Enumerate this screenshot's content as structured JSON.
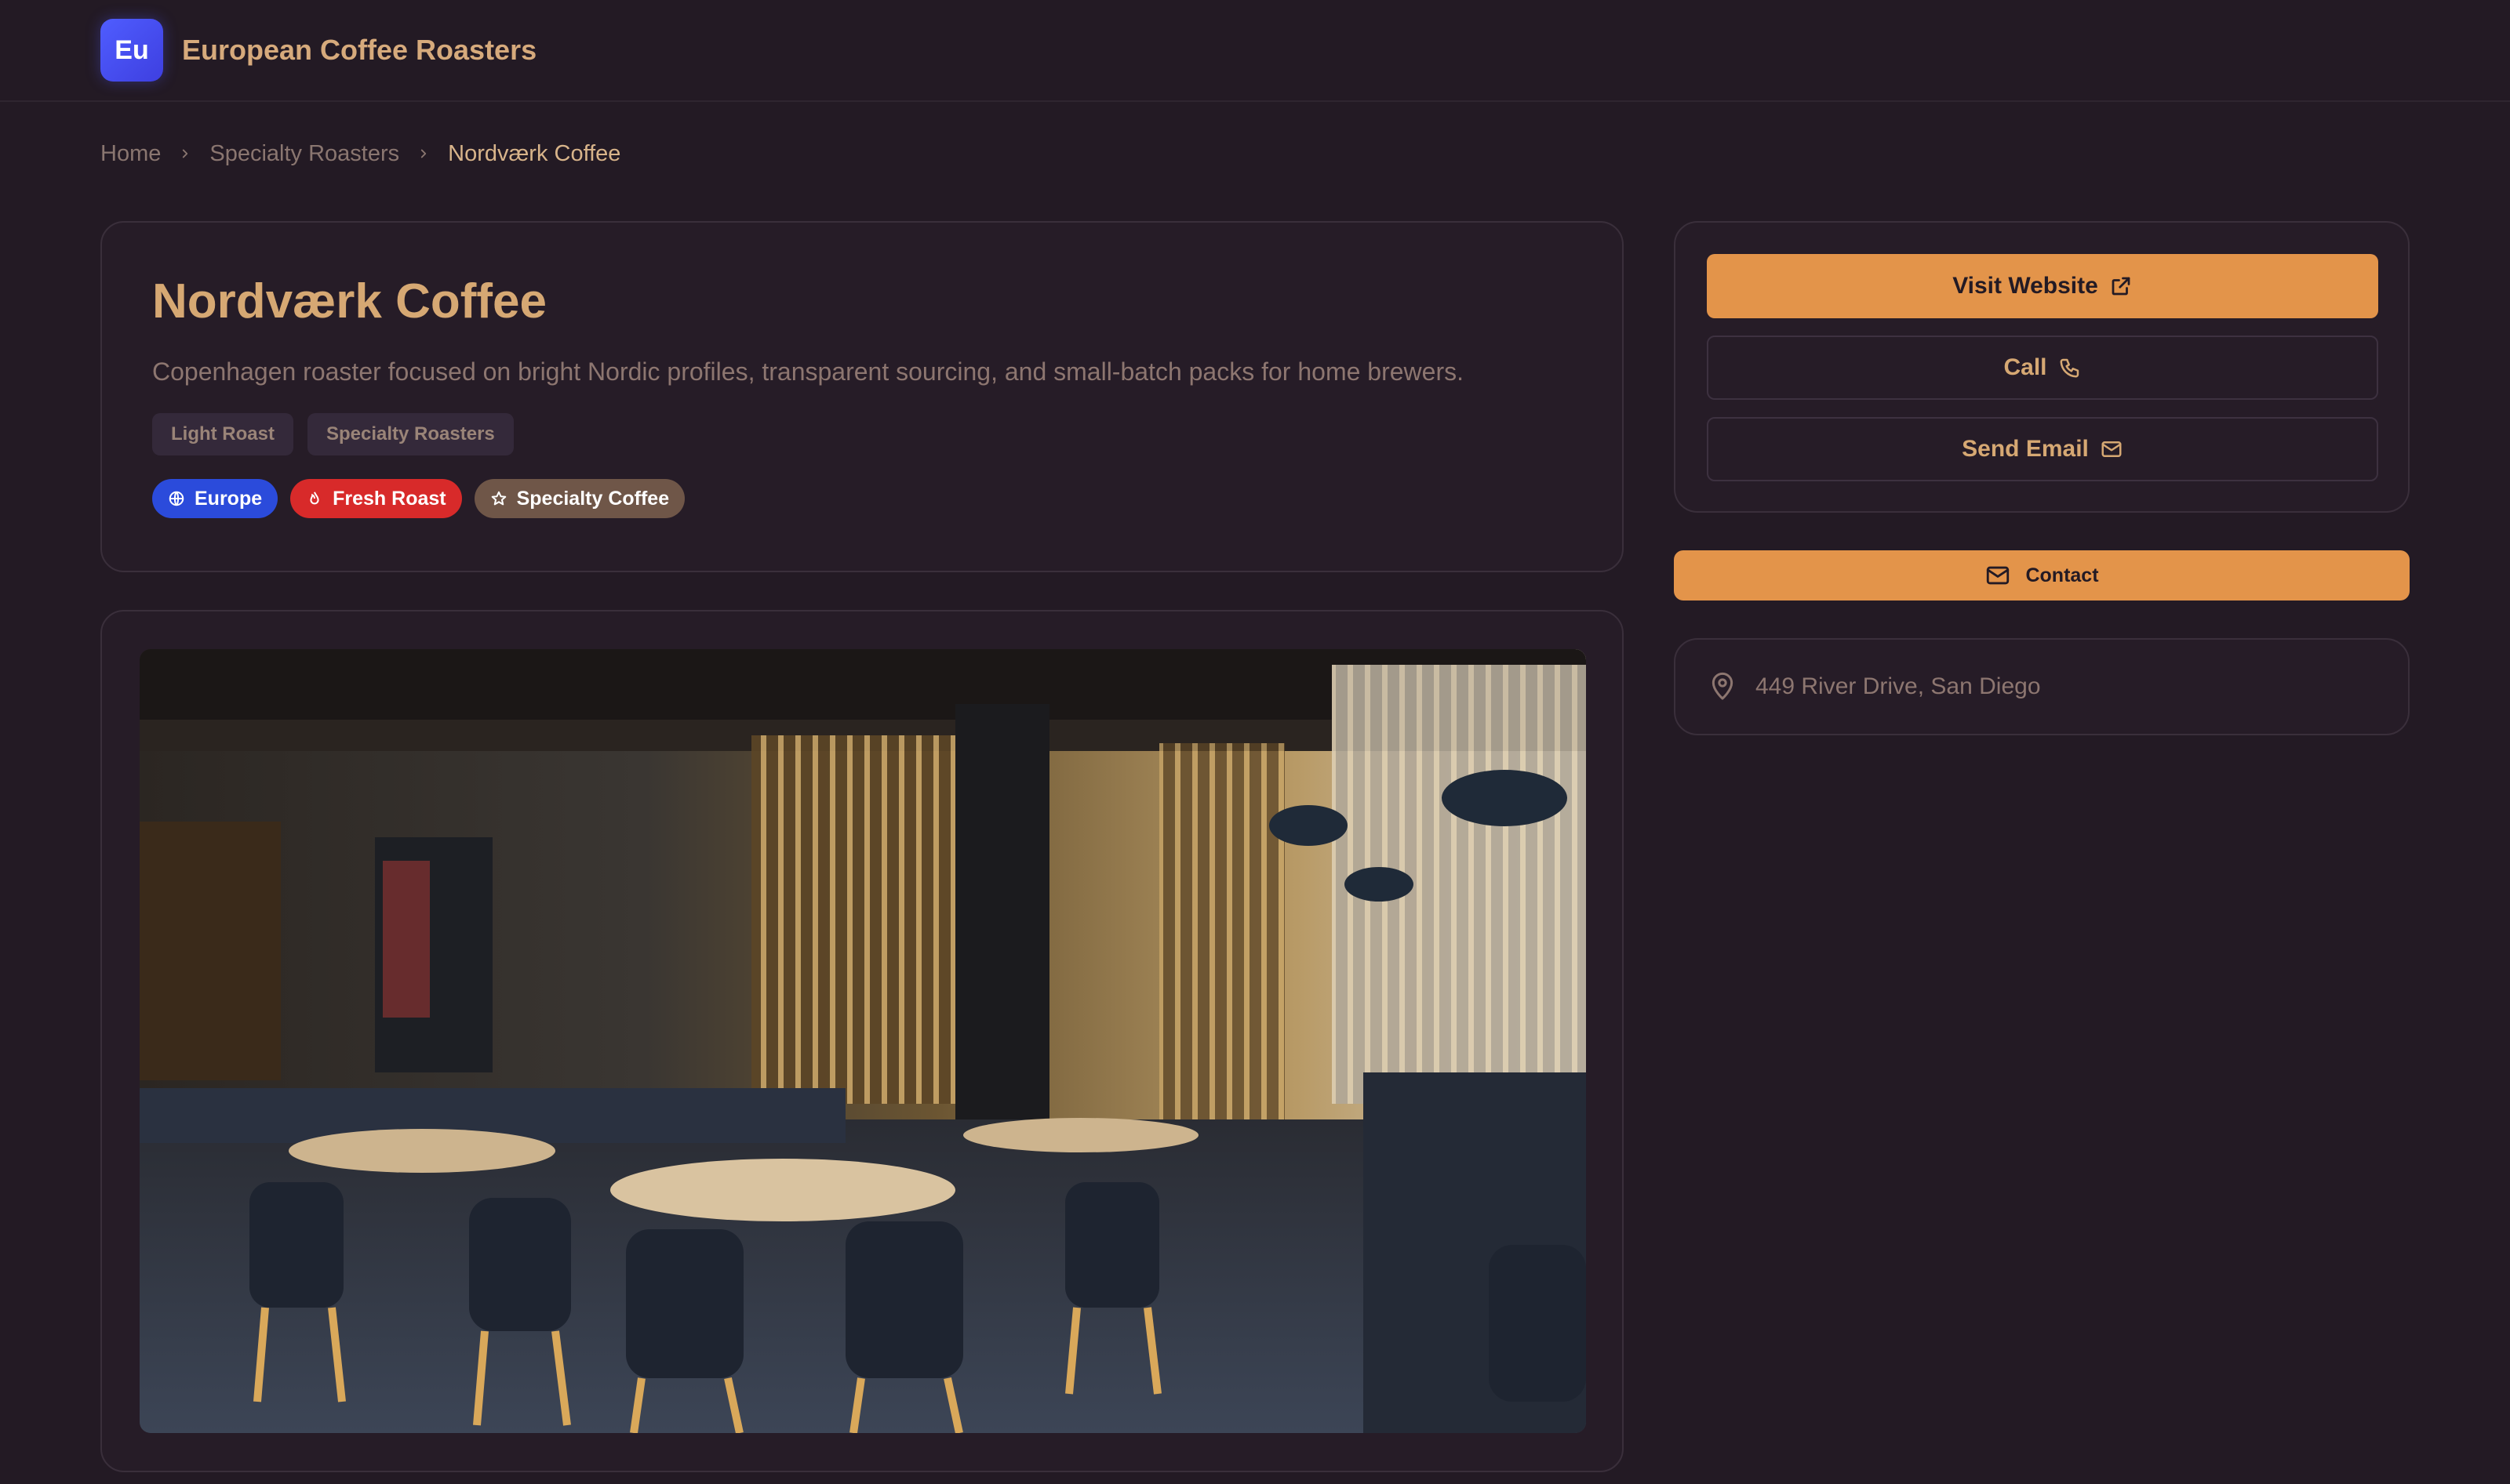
{
  "header": {
    "logo_text": "Eu",
    "app_title": "European Coffee Roasters"
  },
  "breadcrumb": {
    "items": [
      "Home",
      "Specialty Roasters",
      "Nordværk Coffee"
    ]
  },
  "roaster": {
    "name": "Nordværk Coffee",
    "description": "Copenhagen roaster focused on bright Nordic profiles, transparent sourcing, and small-batch packs for home brewers.",
    "tags": [
      "Light Roast",
      "Specialty Roasters"
    ],
    "badges": [
      {
        "label": "Europe",
        "icon": "globe-icon",
        "color": "#2b4bdb"
      },
      {
        "label": "Fresh Roast",
        "icon": "flame-icon",
        "color": "#d82a2a"
      },
      {
        "label": "Specialty Coffee",
        "icon": "star-icon",
        "color": "#6f5648"
      }
    ],
    "photo_alt": "Cafe interior"
  },
  "actions": {
    "visit_website": "Visit Website",
    "call": "Call",
    "send_email": "Send Email",
    "contact": "Contact"
  },
  "location": {
    "address": "449 River Drive, San Diego"
  },
  "colors": {
    "accent": "#e3944a",
    "background": "#231a24",
    "brand": "#4f5dff"
  }
}
